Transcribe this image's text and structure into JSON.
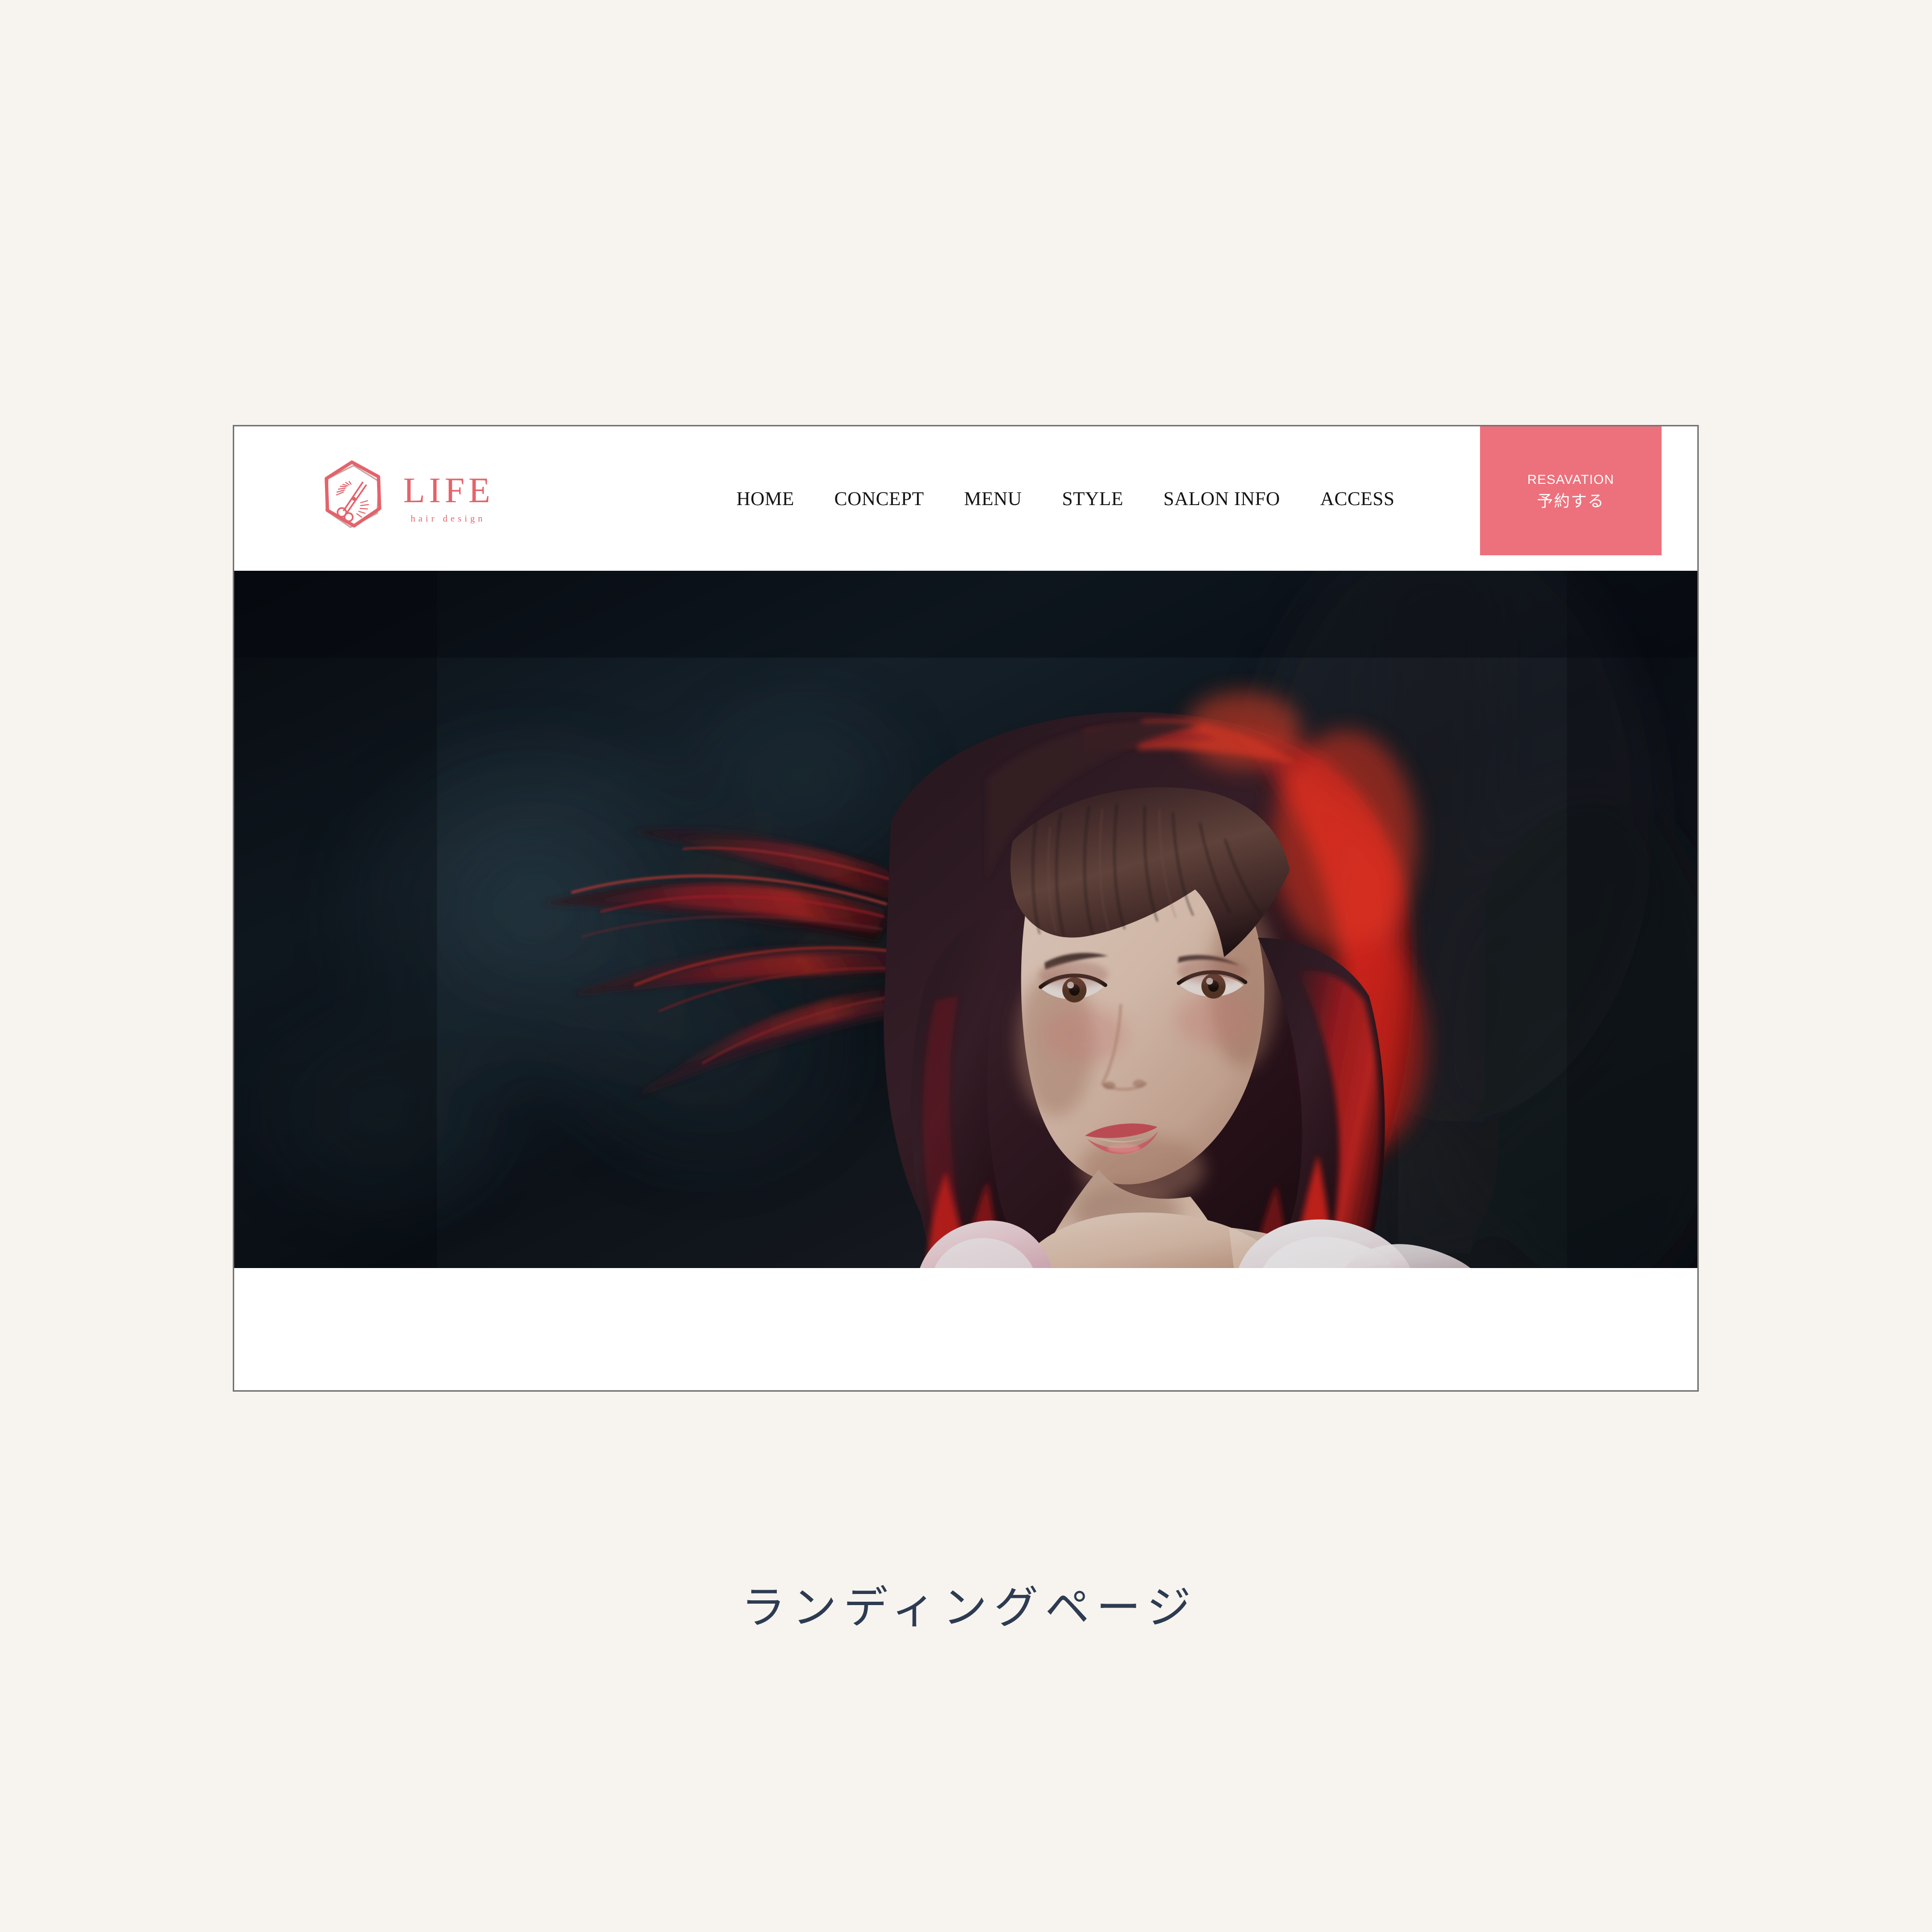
{
  "background_color": "#f7f4ef",
  "browser": {
    "card_border_color": "#737373",
    "card_background": "#ffffff"
  },
  "site": {
    "header": {
      "background": "#ffffff",
      "logo": {
        "icon": "hexagon-scissors-icon",
        "title": "LIFE",
        "subtitle": "hair design",
        "color": "#e4636b"
      },
      "nav": {
        "items": [
          {
            "label": "HOME"
          },
          {
            "label": "CONCEPT"
          },
          {
            "label": "MENU"
          },
          {
            "label": "STYLE"
          },
          {
            "label": "SALON INFO"
          },
          {
            "label": "ACCESS"
          }
        ],
        "text_color": "#131313"
      },
      "reservation_button": {
        "english_label": "RESAVATION",
        "japanese_label": "予約する",
        "background": "#ec717c",
        "text_color": "#ffffff"
      }
    },
    "hero": {
      "alt": "Portrait of a woman with flowing dark hair streaked with vivid red, against a dark blurred teal-slate background, wearing a white off-shoulder ruffled garment",
      "background_color": "#0b1016",
      "accent_hair_color": "#e01f20"
    }
  },
  "caption": {
    "text": "ランディングページ",
    "color": "#2d3b52"
  }
}
